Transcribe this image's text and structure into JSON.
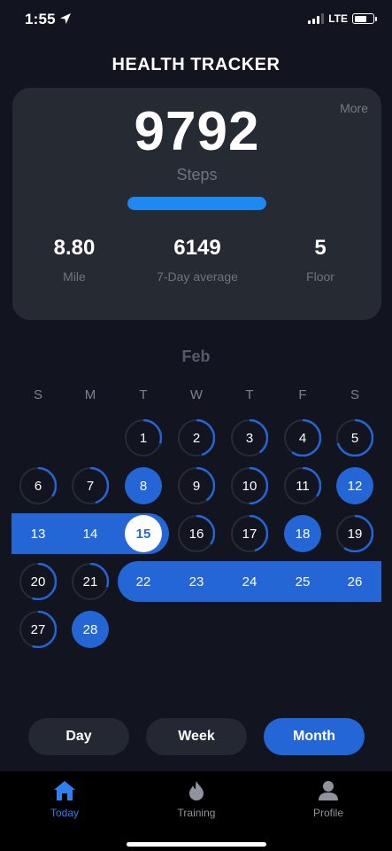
{
  "status": {
    "time": "1:55",
    "network": "LTE",
    "location_icon": "location-arrow-icon"
  },
  "header": {
    "title": "HEALTH TRACKER"
  },
  "summary": {
    "more_label": "More",
    "steps": "9792",
    "steps_label": "Steps",
    "steps_progress": 1.0,
    "metrics": [
      {
        "value": "8.80",
        "label": "Mile"
      },
      {
        "value": "6149",
        "label": "7-Day average"
      },
      {
        "value": "5",
        "label": "Floor"
      }
    ]
  },
  "calendar": {
    "month": "Feb",
    "weekdays": [
      "S",
      "M",
      "T",
      "W",
      "T",
      "F",
      "S"
    ],
    "first_weekday_index": 2,
    "goal_reached_days": [
      8,
      12,
      13,
      14,
      18,
      22,
      23,
      24,
      25,
      26,
      28
    ],
    "today": 15,
    "days": [
      {
        "d": "1",
        "progress": 0.3
      },
      {
        "d": "2",
        "progress": 0.45
      },
      {
        "d": "3",
        "progress": 0.4
      },
      {
        "d": "4",
        "progress": 0.6
      },
      {
        "d": "5",
        "progress": 0.7
      },
      {
        "d": "6",
        "progress": 0.35
      },
      {
        "d": "7",
        "progress": 0.45
      },
      {
        "d": "8",
        "progress": 1.0
      },
      {
        "d": "9",
        "progress": 0.4
      },
      {
        "d": "10",
        "progress": 0.5
      },
      {
        "d": "11",
        "progress": 0.35
      },
      {
        "d": "12",
        "progress": 1.0
      },
      {
        "d": "13",
        "progress": 1.0
      },
      {
        "d": "14",
        "progress": 1.0
      },
      {
        "d": "15",
        "progress": 1.0
      },
      {
        "d": "16",
        "progress": 0.35
      },
      {
        "d": "17",
        "progress": 0.45
      },
      {
        "d": "18",
        "progress": 1.0
      },
      {
        "d": "19",
        "progress": 0.6
      },
      {
        "d": "20",
        "progress": 0.55
      },
      {
        "d": "21",
        "progress": 0.3
      },
      {
        "d": "22",
        "progress": 1.0
      },
      {
        "d": "23",
        "progress": 1.0
      },
      {
        "d": "24",
        "progress": 1.0
      },
      {
        "d": "25",
        "progress": 1.0
      },
      {
        "d": "26",
        "progress": 1.0
      },
      {
        "d": "27",
        "progress": 0.55
      },
      {
        "d": "28",
        "progress": 1.0
      }
    ]
  },
  "range_buttons": [
    {
      "label": "Day",
      "active": false
    },
    {
      "label": "Week",
      "active": false
    },
    {
      "label": "Month",
      "active": true
    }
  ],
  "tabs": [
    {
      "label": "Today",
      "icon": "home-icon",
      "active": true
    },
    {
      "label": "Training",
      "icon": "flame-icon",
      "active": false
    },
    {
      "label": "Profile",
      "icon": "person-icon",
      "active": false
    }
  ],
  "colors": {
    "accent": "#2466d6",
    "progress_bar": "#1e88f3",
    "background": "#121520",
    "card": "#252a33"
  }
}
